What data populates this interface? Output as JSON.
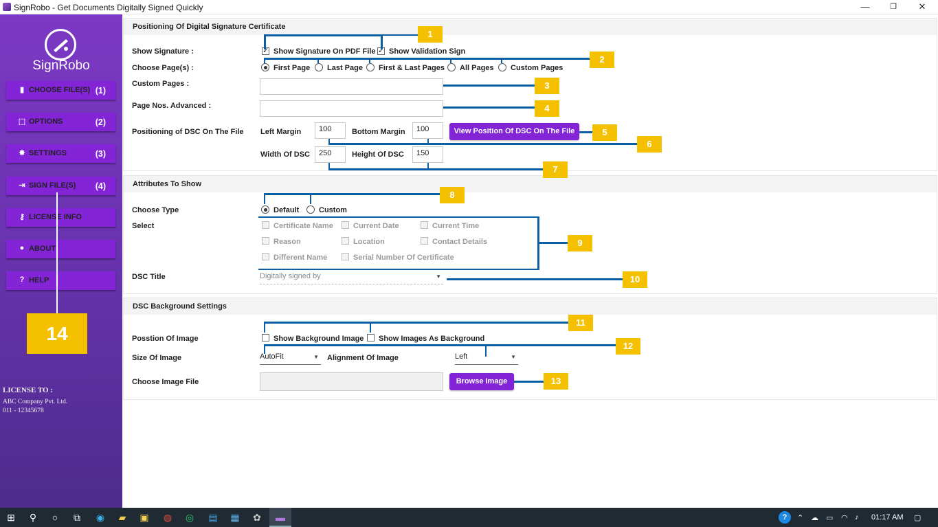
{
  "window": {
    "title": "SignRobo - Get Documents Digitally Signed Quickly",
    "minimize": "—",
    "maximize": "❐",
    "close": "✕"
  },
  "sidebar": {
    "logo_text": "SignRobo",
    "items": [
      {
        "icon": "file-icon",
        "glyph": "▮",
        "label": "CHOOSE FILE(S)",
        "count": "(1)"
      },
      {
        "icon": "options-icon",
        "glyph": "⬚",
        "label": "OPTIONS",
        "count": "(2)"
      },
      {
        "icon": "gear-icon",
        "glyph": "✸",
        "label": "SETTINGS",
        "count": "(3)"
      },
      {
        "icon": "sign-in-icon",
        "glyph": "⇥",
        "label": "SIGN FILE(S)",
        "count": "(4)"
      },
      {
        "icon": "key-icon",
        "glyph": "⚷",
        "label": "LICENSE INFO",
        "count": ""
      },
      {
        "icon": "info-icon",
        "glyph": "●",
        "label": "ABOUT",
        "count": ""
      },
      {
        "icon": "help-icon",
        "glyph": "?",
        "label": "HELP",
        "count": ""
      }
    ],
    "marker": "14",
    "license": {
      "heading": "LICENSE TO :",
      "company": "ABC Company Pvt. Ltd.",
      "phone": "011 - 12345678"
    }
  },
  "positioning": {
    "heading": "Positioning Of Digital Signature Certificate",
    "show_signature_label": "Show Signature :",
    "show_on_pdf": "Show Signature On PDF File",
    "show_validation": "Show Validation Sign",
    "choose_pages_label": "Choose Page(s)  :",
    "pages": [
      "First Page",
      "Last Page",
      "First & Last Pages",
      "All Pages",
      "Custom Pages"
    ],
    "selected_page": "First Page",
    "custom_pages_label": "Custom Pages :",
    "custom_pages_value": "",
    "page_nos_label": "Page Nos. Advanced :",
    "page_nos_value": "",
    "dsc_position_label": "Positioning of DSC On The File",
    "left_margin_label": "Left Margin",
    "left_margin": "100",
    "bottom_margin_label": "Bottom Margin",
    "bottom_margin": "100",
    "view_button": "View Position Of DSC On The File",
    "width_label": "Width Of DSC",
    "width": "250",
    "height_label": "Height Of DSC",
    "height": "150"
  },
  "attributes": {
    "heading": "Attributes To Show",
    "choose_type_label": "Choose Type",
    "types": [
      "Default",
      "Custom"
    ],
    "selected_type": "Default",
    "select_label": "Select",
    "fields": [
      "Certificate Name",
      "Current Date",
      "Current Time",
      "Reason",
      "Location",
      "Contact Details",
      "Different Name",
      "Serial Number Of Certificate"
    ],
    "dsc_title_label": "DSC Title",
    "dsc_title_value": "Digitally signed by"
  },
  "background": {
    "heading": "DSC Background Settings",
    "position_label": "Posstion Of Image",
    "show_bg": "Show Background Image",
    "show_as_bg": "Show Images As Background",
    "size_label": "Size Of Image",
    "size_value": "AutoFit",
    "alignment_label": "Alignment Of Image",
    "alignment_value": "Left",
    "choose_file_label": "Choose Image File",
    "browse_button": "Browse Image"
  },
  "markers": [
    "1",
    "2",
    "3",
    "4",
    "5",
    "6",
    "7",
    "8",
    "9",
    "10",
    "11",
    "12",
    "13"
  ],
  "taskbar": {
    "time": "01:17 AM"
  }
}
